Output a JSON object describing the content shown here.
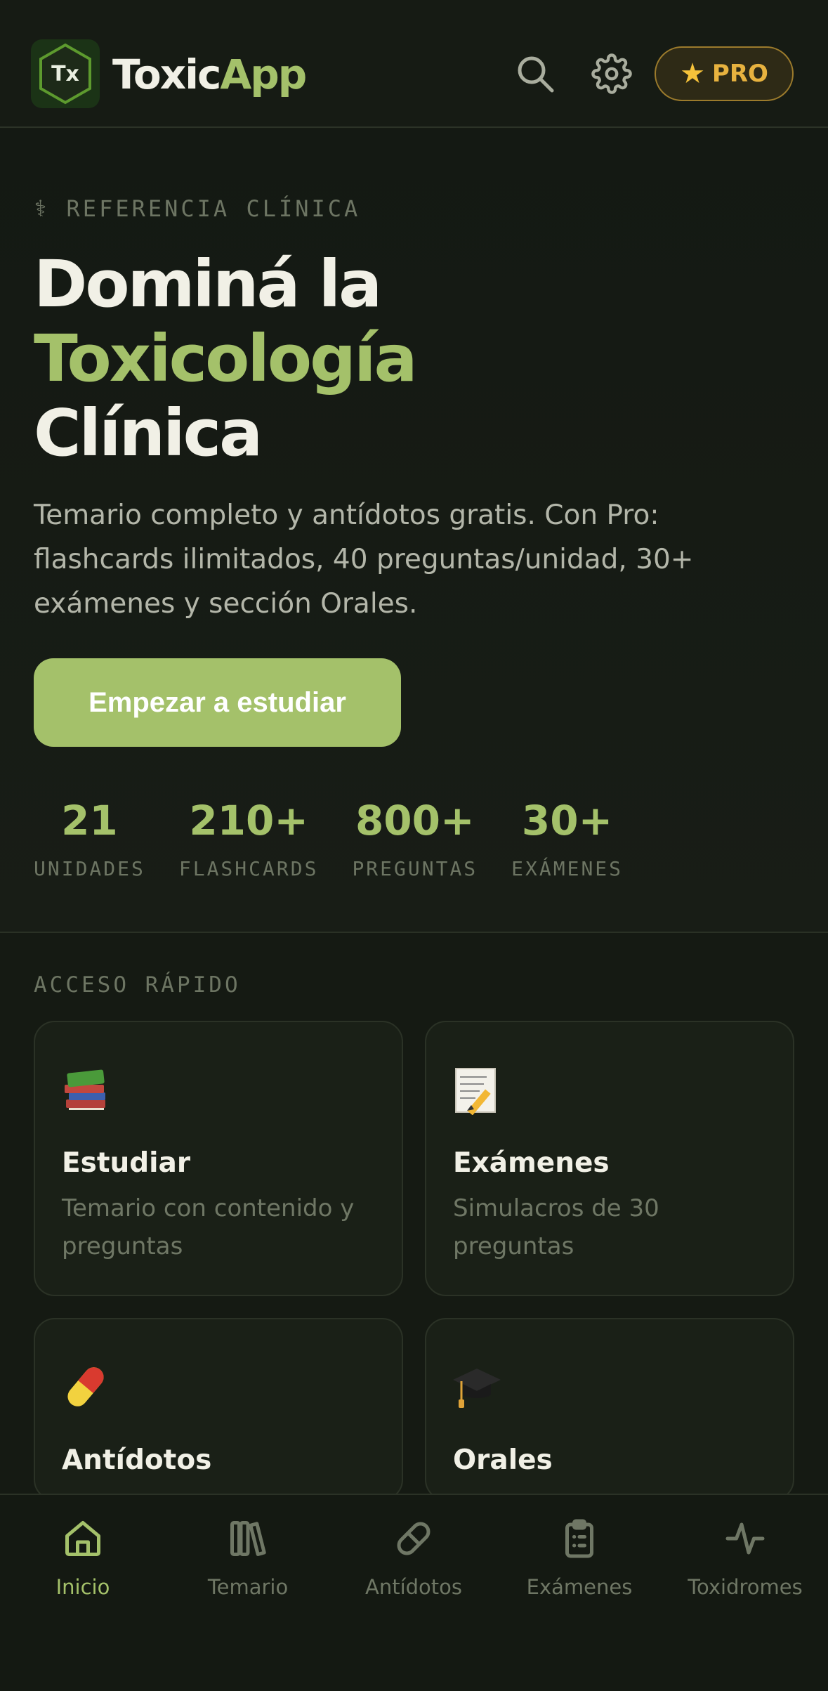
{
  "header": {
    "logo_badge": "Tx",
    "app_name_part1": "Toxic",
    "app_name_part2": "App",
    "pro_label": "PRO",
    "icons": {
      "search": "search-icon",
      "settings": "gear-icon",
      "star": "star-icon"
    }
  },
  "hero": {
    "eyebrow_icon": "caduceus-icon",
    "eyebrow": "REFERENCIA CLÍNICA",
    "title_line1": "Dominá la",
    "title_line2": "Toxicología",
    "title_line3": "Clínica",
    "subtitle": "Temario completo y antídotos gratis. Con Pro: flashcards ilimitados, 40 preguntas/unidad, 30+ exámenes y sección Orales.",
    "cta_label": "Empezar a estudiar"
  },
  "stats": [
    {
      "value": "21",
      "label": "UNIDADES"
    },
    {
      "value": "210+",
      "label": "FLASHCARDS"
    },
    {
      "value": "800+",
      "label": "PREGUNTAS"
    },
    {
      "value": "30+",
      "label": "EXÁMENES"
    }
  ],
  "quick_access": {
    "label": "ACCESO RÁPIDO",
    "cards": [
      {
        "icon": "books-icon",
        "title": "Estudiar",
        "description": "Temario con contenido y preguntas"
      },
      {
        "icon": "memo-icon",
        "title": "Exámenes",
        "description": "Simulacros de 30 preguntas"
      },
      {
        "icon": "pill-icon",
        "title": "Antídotos",
        "description": ""
      },
      {
        "icon": "graduation-cap-icon",
        "title": "Orales",
        "description": ""
      }
    ]
  },
  "bottom_nav": [
    {
      "icon": "home-icon",
      "label": "Inicio",
      "active": true
    },
    {
      "icon": "library-icon",
      "label": "Temario"
    },
    {
      "icon": "pill-icon",
      "label": "Antídotos"
    },
    {
      "icon": "clipboard-icon",
      "label": "Exámenes"
    },
    {
      "icon": "activity-icon",
      "label": "Toxidromes"
    }
  ],
  "colors": {
    "accent": "#a4c16a",
    "background": "#151a13",
    "pro": "#e7b23f"
  }
}
